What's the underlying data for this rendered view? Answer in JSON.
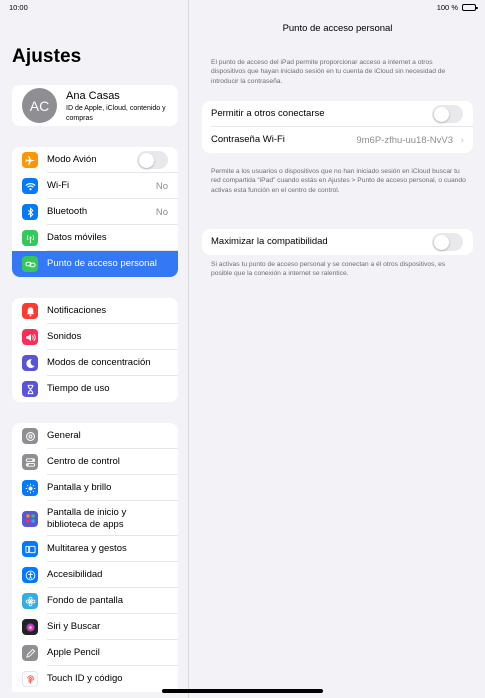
{
  "status": {
    "time": "10:00",
    "battery": "100 %"
  },
  "sidebar": {
    "title": "Ajustes",
    "profile": {
      "initials": "AC",
      "name": "Ana Casas",
      "subtitle": "ID de Apple, iCloud, contenido y compras"
    },
    "group1": [
      {
        "label": "Modo Avión",
        "icon": "airplane-icon",
        "color": "#ff9500",
        "toggle": false
      },
      {
        "label": "Wi-Fi",
        "icon": "wifi-icon",
        "color": "#007aff",
        "value": "No"
      },
      {
        "label": "Bluetooth",
        "icon": "bluetooth-icon",
        "color": "#007aff",
        "value": "No"
      },
      {
        "label": "Datos móviles",
        "icon": "antenna-icon",
        "color": "#34c759"
      },
      {
        "label": "Punto de acceso personal",
        "icon": "hotspot-icon",
        "color": "#34c759",
        "selected": true
      }
    ],
    "group2": [
      {
        "label": "Notificaciones",
        "icon": "bell-icon",
        "color": "#ff3b30"
      },
      {
        "label": "Sonidos",
        "icon": "speaker-icon",
        "color": "#ff2d55"
      },
      {
        "label": "Modos de concentración",
        "icon": "moon-icon",
        "color": "#5856d6"
      },
      {
        "label": "Tiempo de uso",
        "icon": "hourglass-icon",
        "color": "#5856d6"
      }
    ],
    "group3": [
      {
        "label": "General",
        "icon": "gear-icon",
        "color": "#8e8e93"
      },
      {
        "label": "Centro de control",
        "icon": "switches-icon",
        "color": "#8e8e93"
      },
      {
        "label": "Pantalla y brillo",
        "icon": "sun-icon",
        "color": "#007aff"
      },
      {
        "label": "Pantalla de inicio y biblioteca de apps",
        "icon": "grid-icon",
        "color": "#5856d6"
      },
      {
        "label": "Multitarea y gestos",
        "icon": "multitask-icon",
        "color": "#007aff"
      },
      {
        "label": "Accesibilidad",
        "icon": "accessibility-icon",
        "color": "#007aff"
      },
      {
        "label": "Fondo de pantalla",
        "icon": "flower-icon",
        "color": "#32ade6"
      },
      {
        "label": "Siri y Buscar",
        "icon": "siri-icon",
        "color": "#222222"
      },
      {
        "label": "Apple Pencil",
        "icon": "pencil-icon",
        "color": "#8e8e93"
      },
      {
        "label": "Touch ID y código",
        "icon": "fingerprint-icon",
        "color": "#ff3b30"
      }
    ]
  },
  "main": {
    "title": "Punto de acceso personal",
    "intro": "El punto de acceso del iPad permite proporcionar acceso a internet a otros dispositivos que hayan iniciado sesión en tu cuenta de iCloud sin necesidad de introducir la contraseña.",
    "allow_label": "Permitir a otros conectarse",
    "allow_on": false,
    "wifi_pass_label": "Contraseña Wi-Fi",
    "wifi_pass_value": "9m6P-zfhu-uu18-NvV3",
    "allow_note": "Permite a los usuarios o dispositivos que no han iniciado sesión en iCloud buscar tu red compartida “iPad” cuando estás en Ajustes > Punto de acceso personal, o cuando activas esta función en el centro de control.",
    "compat_label": "Maximizar la compatibilidad",
    "compat_on": false,
    "compat_note": "Si activas tu punto de acceso personal y se conectan a él otros dispositivos, es posible que la conexión a internet se ralentice."
  }
}
